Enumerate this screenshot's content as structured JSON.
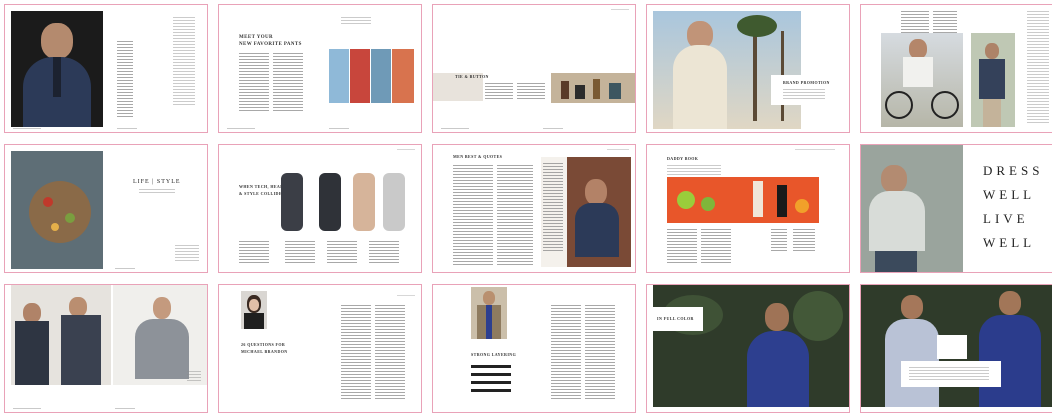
{
  "spreads": {
    "s2": {
      "heading1": "MEET YOUR",
      "heading2": "NEW FAVORITE PANTS"
    },
    "s3": {
      "heading": "TIE & BUTTON"
    },
    "s4": {
      "label": "BRAND PROMOTION"
    },
    "s6": {
      "title": "LIFE | STYLE"
    },
    "s7": {
      "line1": "WHEN TECH, HEALTH",
      "line2": "& STYLE COLLIDE"
    },
    "s8": {
      "heading": "MEN BEST & QUOTES"
    },
    "s9": {
      "heading": "DADDY BOOK"
    },
    "s10": {
      "word1": "DRESS",
      "word2": "WELL",
      "word3": "LIVE",
      "word4": "WELL"
    },
    "s12": {
      "heading1": "26 QUESTIONS FOR",
      "heading2": "MICHAEL BRANDON"
    },
    "s13": {
      "heading": "STRONG LAYERING"
    },
    "s14": {
      "label": "IN FULL COLOR"
    }
  },
  "colors": {
    "border": "#e9a2b8",
    "suit_navy": "#2c3a58",
    "sweater_blue": "#2d3f8f",
    "foliage": "#2f3b2a",
    "sky": "#a9c6dd",
    "citrus": "#e8562a"
  }
}
